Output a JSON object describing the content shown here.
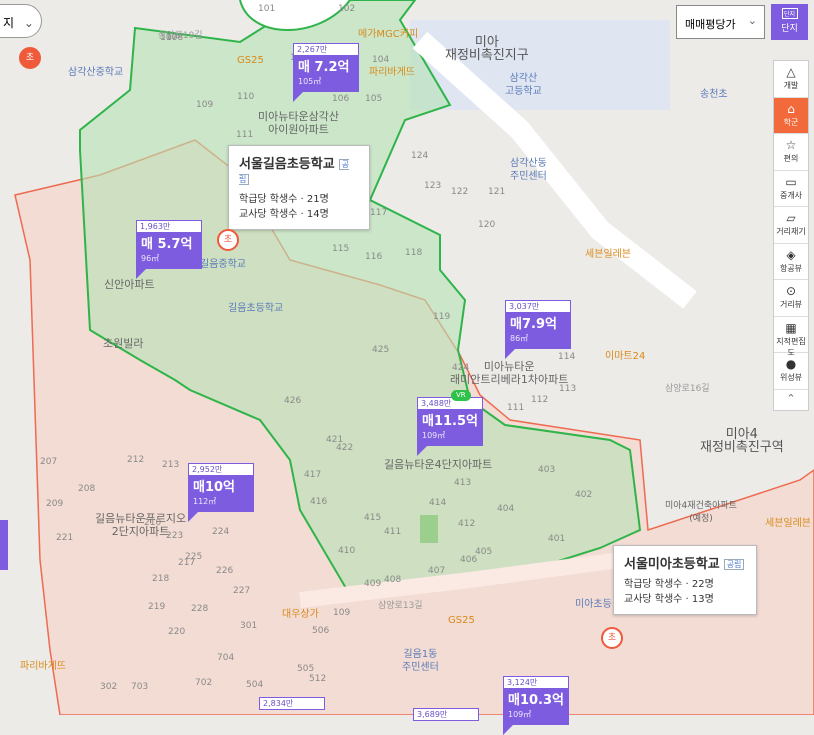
{
  "top_left_button": {
    "label": "지"
  },
  "price_select": {
    "value": "매매평당가"
  },
  "complex_button": {
    "label": "단지",
    "icon_text": "단지"
  },
  "toolbar": [
    {
      "label": "개발",
      "icon": "cone-icon"
    },
    {
      "label": "학군",
      "icon": "school-icon",
      "active": true
    },
    {
      "label": "편의",
      "icon": "star-icon"
    },
    {
      "label": "중개사",
      "icon": "agent-icon"
    },
    {
      "label": "거리재기",
      "icon": "ruler-icon"
    },
    {
      "label": "항공뷰",
      "icon": "aerial-icon"
    },
    {
      "label": "거리뷰",
      "icon": "street-pin-icon"
    },
    {
      "label": "지적편집도",
      "icon": "cadastral-icon"
    },
    {
      "label": "위성뷰",
      "icon": "globe-icon"
    },
    {
      "label": "^",
      "icon": "collapse-icon"
    }
  ],
  "markers": [
    {
      "per_pyeong": "2,267만",
      "price": "매 7.2억",
      "area": "105㎡"
    },
    {
      "per_pyeong": "1,963만",
      "price": "매 5.7억",
      "area": "96㎡"
    },
    {
      "per_pyeong": "3,037만",
      "price": "매7.9억",
      "area": "86㎡"
    },
    {
      "per_pyeong": "3,488만",
      "price": "매11.5억",
      "area": "109㎡",
      "badge": "VR"
    },
    {
      "per_pyeong": "2,952만",
      "price": "매10억",
      "area": "112㎡"
    },
    {
      "per_pyeong": "3,124만",
      "price": "매10.3억",
      "area": "109㎡"
    },
    {
      "per_pyeong": "2,834만"
    },
    {
      "per_pyeong": "3,689만"
    }
  ],
  "schools": [
    {
      "name": "서울길음초등학교",
      "type": "공립",
      "students_per_class": "학급당 학생수 · 21명",
      "students_per_teacher": "교사당 학생수 · 14명"
    },
    {
      "name": "서울미아초등학교",
      "type": "공립",
      "students_per_class": "학급당 학생수 · 22명",
      "students_per_teacher": "교사당 학생수 · 13명"
    }
  ],
  "school_icon_text": "초",
  "map_labels": [
    "삼각산중학교",
    "미아\n재정비촉진지구",
    "삼각산\n고등학교",
    "송천초",
    "미아뉴타운삼각산\n아이원아파트",
    "삼각산동\n주민센터",
    "세븐일레븐",
    "신안아파트",
    "길음중학교",
    "길음초등학교",
    "초원빌라",
    "미아뉴타운\n래미안트리베라1차아파트",
    "이마트24",
    "길음뉴타운4단지아파트",
    "미아4\n재정비촉진구역",
    "미아4재건축아파트\n(예정)",
    "세븐일레븐",
    "길음뉴타운푸르지오\n2단지아파트",
    "대우상가",
    "GS25",
    "길음1동\n주민센터",
    "파리바게뜨",
    "GS25",
    "파리바게뜨",
    "메가MGC커피",
    "미아초등",
    "삼양로13길",
    "삼양로19길",
    "삼양로16길"
  ],
  "building_numbers": [
    "101",
    "102",
    "103",
    "104",
    "105",
    "106",
    "107",
    "108",
    "109",
    "110",
    "111",
    "115",
    "116",
    "117",
    "118",
    "119",
    "120",
    "121",
    "122",
    "123",
    "124",
    "424",
    "425",
    "426",
    "422",
    "421",
    "417",
    "416",
    "415",
    "414",
    "413",
    "412",
    "411",
    "410",
    "409",
    "408",
    "407",
    "406",
    "405",
    "404",
    "403",
    "402",
    "401",
    "207",
    "208",
    "209",
    "210",
    "212",
    "213",
    "217",
    "218",
    "219",
    "220",
    "221",
    "223",
    "224",
    "225",
    "226",
    "227",
    "228",
    "301",
    "302",
    "703",
    "704",
    "702",
    "504",
    "505",
    "506",
    "512",
    "109",
    "114",
    "113",
    "112",
    "111"
  ]
}
